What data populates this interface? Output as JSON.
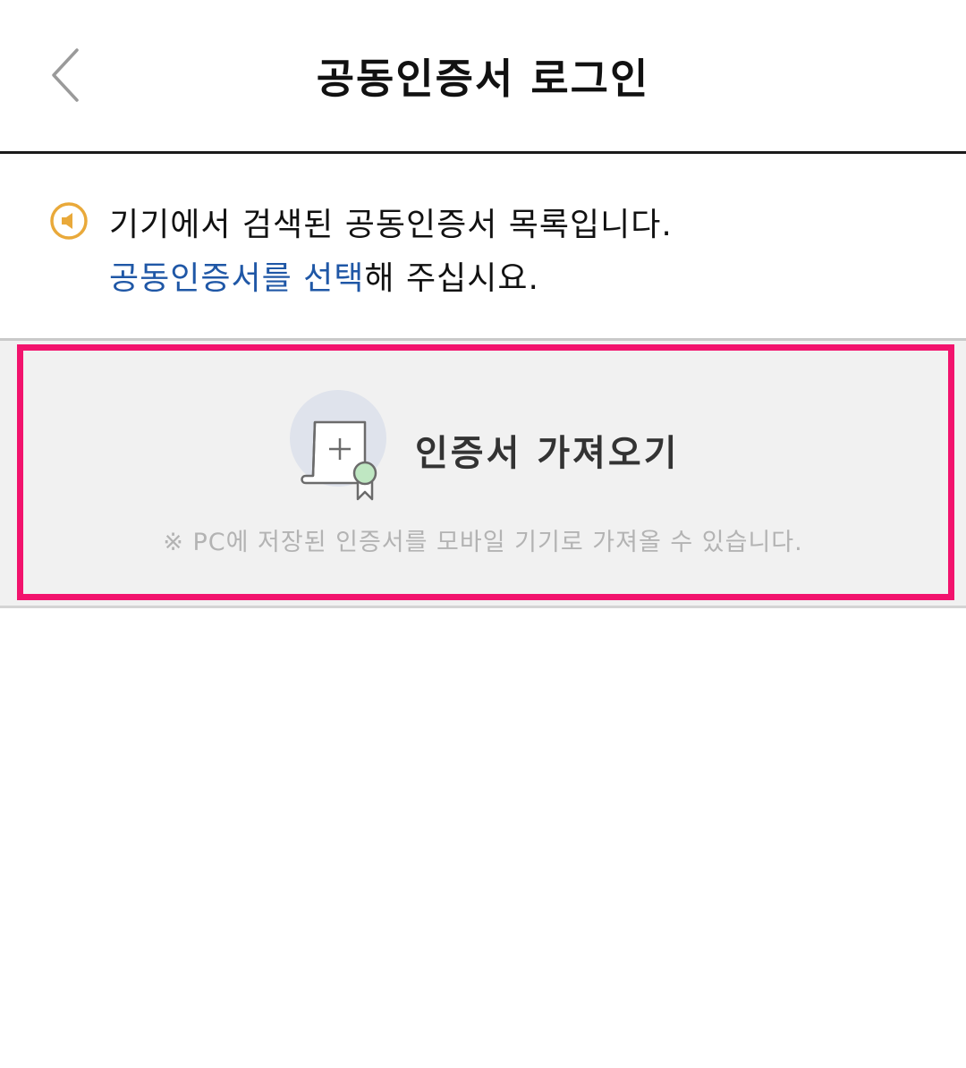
{
  "header": {
    "title": "공동인증서 로그인",
    "back_icon": "chevron-left-icon"
  },
  "notice": {
    "icon": "speaker-icon",
    "icon_color": "#e9a93a",
    "line1": "기기에서 검색된 공동인증서 목록입니다.",
    "line2_accent": "공동인증서를 선택",
    "line2_rest": "해 주십시요.",
    "accent_color": "#1f57a6"
  },
  "import": {
    "icon": "certificate-add-icon",
    "label": "인증서 가져오기",
    "hint": "※ PC에 저장된 인증서를 모바일 기기로 가져올 수 있습니다.",
    "highlight_color": "#f2136d"
  }
}
